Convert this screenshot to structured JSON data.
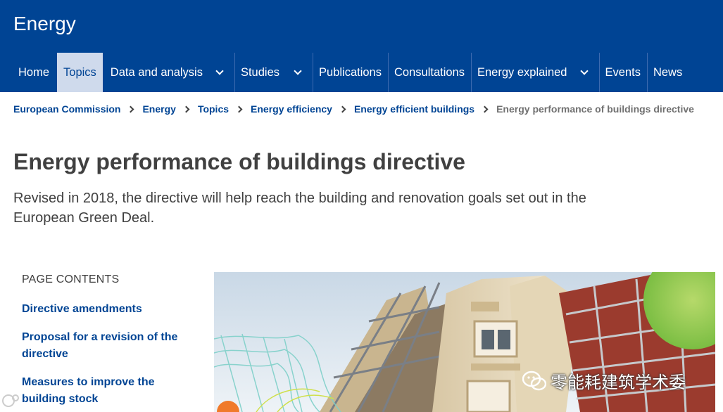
{
  "site": {
    "title": "Energy"
  },
  "nav": {
    "items": [
      {
        "label": "Home",
        "dropdown": false,
        "active": false
      },
      {
        "label": "Topics",
        "dropdown": false,
        "active": true
      },
      {
        "label": "Data and analysis",
        "dropdown": true,
        "active": false
      },
      {
        "label": "Studies",
        "dropdown": true,
        "active": false
      },
      {
        "label": "Publications",
        "dropdown": false,
        "active": false
      },
      {
        "label": "Consultations",
        "dropdown": false,
        "active": false
      },
      {
        "label": "Energy explained",
        "dropdown": true,
        "active": false
      },
      {
        "label": "Events",
        "dropdown": false,
        "active": false
      },
      {
        "label": "News",
        "dropdown": false,
        "active": false
      }
    ]
  },
  "breadcrumb": [
    "European Commission",
    "Energy",
    "Topics",
    "Energy efficiency",
    "Energy efficient buildings",
    "Energy performance of buildings directive"
  ],
  "page": {
    "title": "Energy performance of buildings directive",
    "intro": "Revised in 2018, the directive will help reach the building and renovation goals set out in the European Green Deal."
  },
  "toc": {
    "heading": "PAGE CONTENTS",
    "links": [
      "Directive amendments",
      "Proposal for a revision of the directive",
      "Measures to improve the building stock"
    ]
  },
  "watermark": {
    "text": "零能耗建筑学术委"
  },
  "colors": {
    "brand": "#004494",
    "nav_active_bg": "#cfdaec",
    "text": "#404040",
    "muted": "#707070"
  }
}
